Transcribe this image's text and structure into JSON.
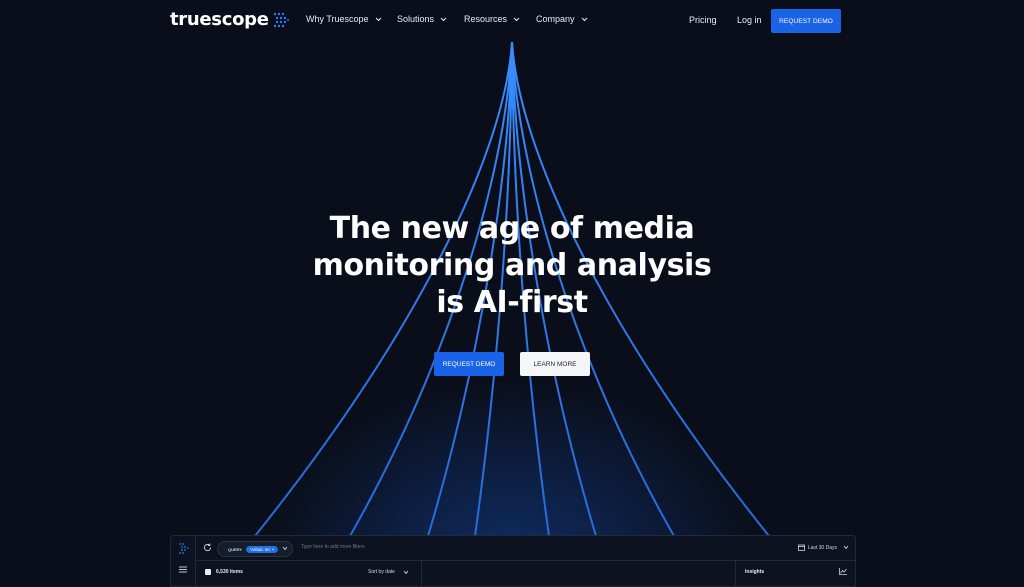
{
  "brand": {
    "name": "truescope",
    "accent_color": "#1a63e6",
    "background_color": "#0a0e1a"
  },
  "nav": {
    "menu": [
      {
        "label": "Why Truescope",
        "icon": "chevron-down-icon"
      },
      {
        "label": "Solutions",
        "icon": "chevron-down-icon"
      },
      {
        "label": "Resources",
        "icon": "chevron-down-icon"
      },
      {
        "label": "Company",
        "icon": "chevron-down-icon"
      }
    ],
    "pricing": "Pricing",
    "login": "Log in",
    "request_demo": "REQUEST DEMO"
  },
  "hero": {
    "title_line1": "The new age of media",
    "title_line2": "monitoring and analysis",
    "title_line3": "is AI-first",
    "primary_button": "REQUEST DEMO",
    "secondary_button": "LEARN MORE"
  },
  "app_preview": {
    "query_label": "QUERY",
    "query_tag": "Voltaic Inc ×",
    "filter_placeholder": "Type here to add more filters",
    "date_range": "Last 30 Days",
    "items_count": "6,530 items",
    "sort": "Sort by date",
    "panel_title": "Insights"
  }
}
